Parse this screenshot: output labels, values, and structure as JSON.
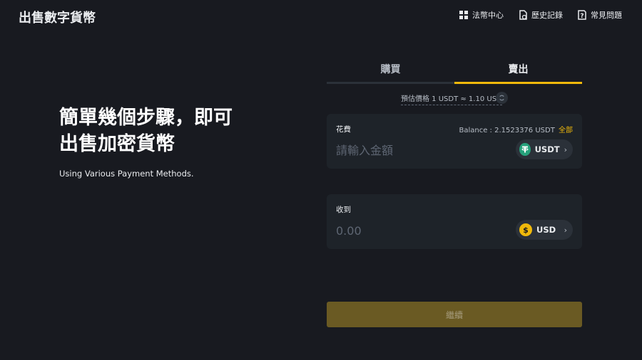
{
  "header": {
    "title": "出售數字貨幣",
    "nav": [
      {
        "label": "法幣中心",
        "icon": "grid-icon"
      },
      {
        "label": "歷史記錄",
        "icon": "history-icon"
      },
      {
        "label": "常見問題",
        "icon": "help-icon"
      }
    ]
  },
  "hero": {
    "line1": "簡單幾個步驟，即可",
    "line2": "出售加密貨幣",
    "subtitle": "Using Various Payment Methods."
  },
  "trade": {
    "tabs": [
      "購買",
      "賣出"
    ],
    "active_tab": "賣出",
    "price_info": "預估價格 1 USDT ≈ 1.10 USD",
    "spend": {
      "label": "花費",
      "balance": "Balance : 2.1523376 USDT",
      "all_label": "全部",
      "placeholder": "請輸入金額",
      "value": "",
      "coin": "USDT",
      "coin_color": "#26a17b"
    },
    "receive": {
      "label": "收到",
      "value": "0.00",
      "coin": "USD",
      "coin_color": "#f0b90b"
    },
    "continue_label": "繼續"
  },
  "colors": {
    "background": "#181a20",
    "card": "#1e2329",
    "accent": "#f0b90b",
    "button_disabled": "#6a5a23"
  }
}
